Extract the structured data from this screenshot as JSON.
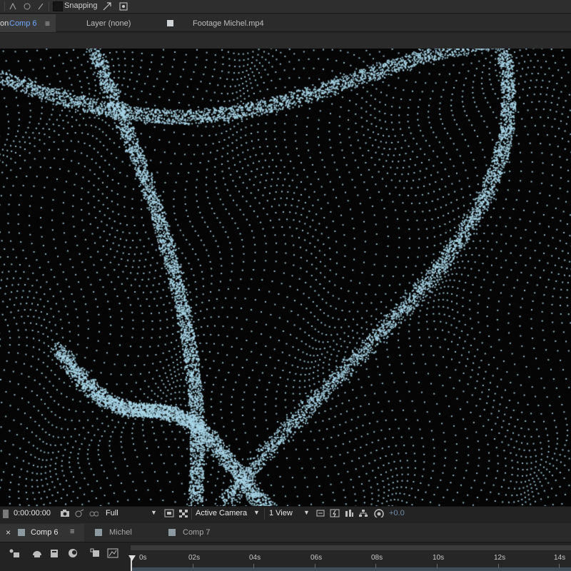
{
  "toolbar": {
    "snapping_label": "Snapping",
    "snapping_checked": false
  },
  "comp_tabs": {
    "active_prefix": "on",
    "active_label": "Comp 6",
    "menu_glyph": "≡",
    "layer_tab": "Layer (none)",
    "footage_tab": "Footage Michel.mp4"
  },
  "viewer_controls": {
    "timecode": "0:00:00:00",
    "resolution": "Full",
    "camera": "Active Camera",
    "view_layout": "1 View",
    "exposure": "+0.0",
    "dropdown_glyph": "▼"
  },
  "timeline": {
    "tabs": [
      "Comp 6",
      "Michel",
      "Comp 7"
    ],
    "close_glyph": "×",
    "menu_glyph": "≡",
    "ruler_labels": [
      "0s",
      "02s",
      "04s",
      "06s",
      "08s",
      "10s",
      "12s",
      "14s"
    ]
  },
  "colors": {
    "accent": "#6fa8ff",
    "particle": "#a9d6e8",
    "viewer_bg": "#050505",
    "panel_bg": "#232323"
  }
}
